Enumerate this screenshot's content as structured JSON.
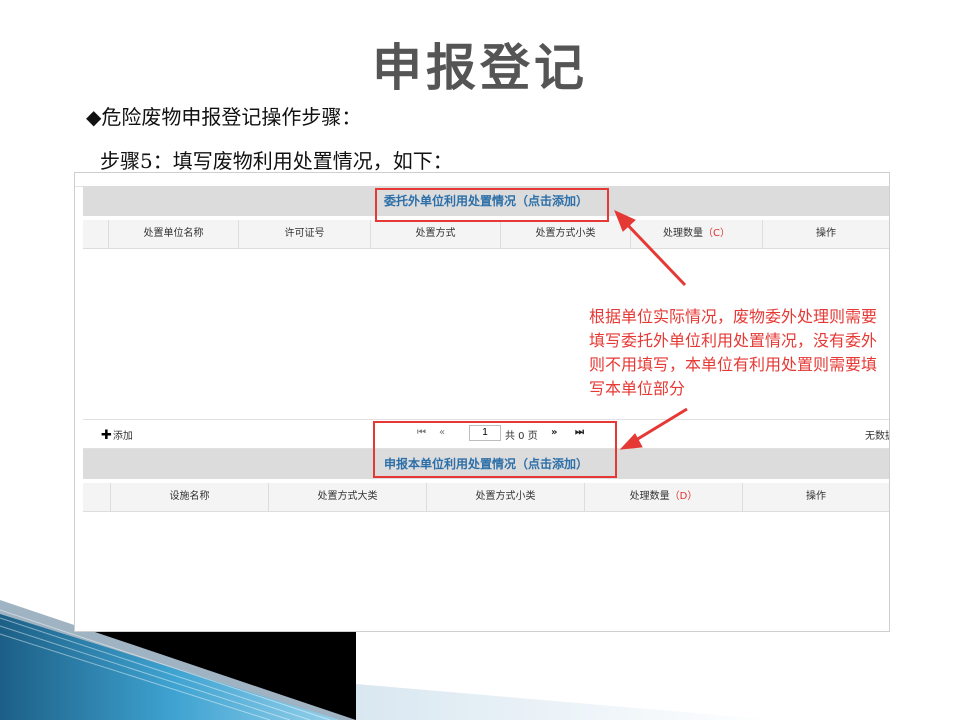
{
  "slide": {
    "title": "申报登记",
    "bullet": "◆危险废物申报登记操作步骤：",
    "step": "步骤5：填写废物利用处置情况，如下："
  },
  "screenshot": {
    "section1": {
      "header": "委托外单位利用处置情况（点击添加）",
      "columns": [
        "处置单位名称",
        "许可证号",
        "处置方式",
        "处置方式小类",
        "处理数量",
        "操作"
      ],
      "qty_tag": "（C）"
    },
    "pager": {
      "add_label": "添加",
      "page_value": "1",
      "total_pages": "共 0 页",
      "no_data": "无数据"
    },
    "section2": {
      "header": "申报本单位利用处置情况（点击添加）",
      "columns": [
        "设施名称",
        "处置方式大类",
        "处置方式小类",
        "处理数量",
        "操作"
      ],
      "qty_tag": "（D）"
    },
    "annotation": "根据单位实际情况，废物委外处理则需要填写委托外单位利用处置情况，没有委外则不用填写，本单位有利用处置则需要填写本单位部分"
  },
  "colors": {
    "highlight": "#e53935",
    "header_text": "#2d6fa8",
    "header_bg": "#dcdcdc"
  }
}
